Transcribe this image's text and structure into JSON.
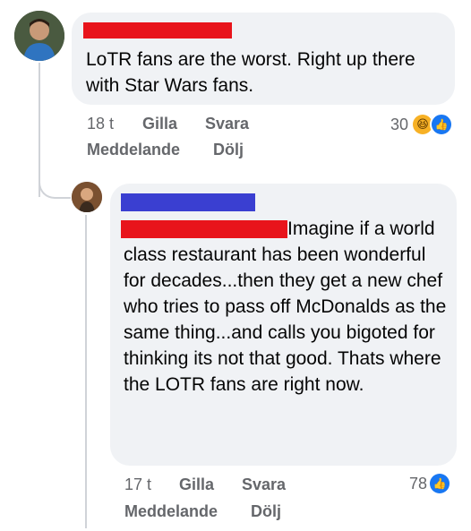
{
  "comments": [
    {
      "text": "LoTR fans are the worst. Right up there with Star Wars fans.",
      "time": "18 t",
      "like_label": "Gilla",
      "reply_label": "Svara",
      "message_label": "Meddelande",
      "hide_label": "Dölj",
      "reaction_count": "30"
    },
    {
      "text": "Imagine if a world class restaurant has been wonderful for decades...then they get a new chef who tries to pass off McDonalds as the same thing...and calls you bigoted for thinking its not that good. Thats where the LOTR fans are right now.",
      "time": "17 t",
      "like_label": "Gilla",
      "reply_label": "Svara",
      "message_label": "Meddelande",
      "hide_label": "Dölj",
      "reaction_count": "78"
    }
  ],
  "colors": {
    "bubble": "#f0f2f5",
    "redact_red": "#e8141b",
    "redact_blue": "#3a3fd1",
    "meta": "#65676b",
    "like_blue": "#1877f2",
    "haha_yellow": "#f7b125"
  }
}
